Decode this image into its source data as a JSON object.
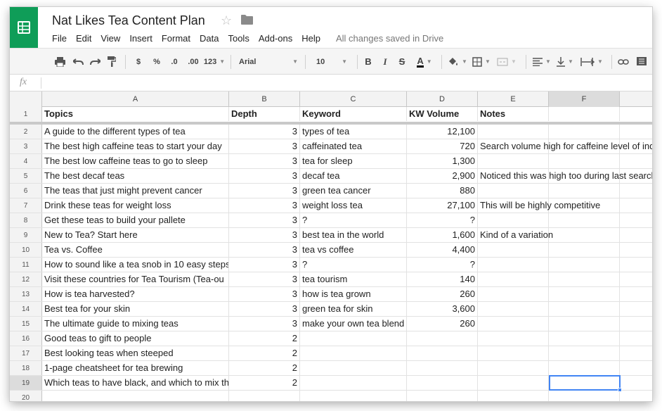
{
  "doc": {
    "title": "Nat Likes Tea Content Plan",
    "save_status": "All changes saved in Drive"
  },
  "menu": [
    "File",
    "Edit",
    "View",
    "Insert",
    "Format",
    "Data",
    "Tools",
    "Add-ons",
    "Help"
  ],
  "toolbar": {
    "currency": "$",
    "percent": "%",
    "decrease_decimals": ".0",
    "increase_decimals": ".00",
    "more_formats": "123",
    "font": "Arial",
    "font_size": "10",
    "bold": "B",
    "italic": "I",
    "strikethrough": "S",
    "text_color": "A"
  },
  "formula_bar": {
    "fx_label": "fx",
    "value": ""
  },
  "columns": [
    "A",
    "B",
    "C",
    "D",
    "E",
    "F"
  ],
  "header_row": {
    "number": "1",
    "cells": [
      "Topics",
      "Depth",
      "Keyword",
      "KW Volume",
      "Notes",
      ""
    ]
  },
  "rows": [
    {
      "n": "2",
      "a": "A guide to the different types of tea",
      "b": "3",
      "c": "types of tea",
      "d": "12,100",
      "e": ""
    },
    {
      "n": "3",
      "a": "The best high caffeine teas to start your day",
      "b": "3",
      "c": "caffeinated tea",
      "d": "720",
      "e": "Search volume high for caffeine level of ind"
    },
    {
      "n": "4",
      "a": "The best low caffeine teas to go to sleep",
      "b": "3",
      "c": "tea for sleep",
      "d": "1,300",
      "e": ""
    },
    {
      "n": "5",
      "a": "The best decaf teas",
      "b": "3",
      "c": "decaf tea",
      "d": "2,900",
      "e": "Noticed this was high too during last search"
    },
    {
      "n": "6",
      "a": "The teas that just might prevent cancer",
      "b": "3",
      "c": "green tea cancer",
      "d": "880",
      "e": ""
    },
    {
      "n": "7",
      "a": "Drink these teas for weight loss",
      "b": "3",
      "c": "weight loss tea",
      "d": "27,100",
      "e": "This will be highly competitive"
    },
    {
      "n": "8",
      "a": "Get these teas to build your pallete",
      "b": "3",
      "c": "?",
      "d": "?",
      "e": ""
    },
    {
      "n": "9",
      "a": "New to Tea? Start here",
      "b": "3",
      "c": "best tea in the world",
      "d": "1,600",
      "e": "Kind of a variation"
    },
    {
      "n": "10",
      "a": "Tea vs. Coffee",
      "b": "3",
      "c": "tea vs coffee",
      "d": "4,400",
      "e": ""
    },
    {
      "n": "11",
      "a": "How to sound like a tea snob in 10 easy steps",
      "b": "3",
      "c": "?",
      "d": "?",
      "e": ""
    },
    {
      "n": "12",
      "a": "Visit these countries for Tea Tourism (Tea-ou",
      "b": "3",
      "c": "tea tourism",
      "d": "140",
      "e": ""
    },
    {
      "n": "13",
      "a": "How is tea harvested?",
      "b": "3",
      "c": "how is tea grown",
      "d": "260",
      "e": ""
    },
    {
      "n": "14",
      "a": "Best tea for your skin",
      "b": "3",
      "c": "green tea for skin",
      "d": "3,600",
      "e": ""
    },
    {
      "n": "15",
      "a": "The ultimate guide to mixing teas",
      "b": "3",
      "c": "make your own tea blend",
      "d": "260",
      "e": ""
    },
    {
      "n": "16",
      "a": "Good teas to gift to people",
      "b": "2",
      "c": "",
      "d": "",
      "e": ""
    },
    {
      "n": "17",
      "a": "Best looking teas when steeped",
      "b": "2",
      "c": "",
      "d": "",
      "e": ""
    },
    {
      "n": "18",
      "a": "1-page cheatsheet for tea brewing",
      "b": "2",
      "c": "",
      "d": "",
      "e": ""
    },
    {
      "n": "19",
      "a": "Which teas to have black, and which to mix th",
      "b": "2",
      "c": "",
      "d": "",
      "e": ""
    },
    {
      "n": "20",
      "a": "",
      "b": "",
      "c": "",
      "d": "",
      "e": ""
    }
  ],
  "selection": {
    "cell": "F19"
  },
  "colors": {
    "brand": "#0f9d58",
    "selection": "#4285f4"
  }
}
